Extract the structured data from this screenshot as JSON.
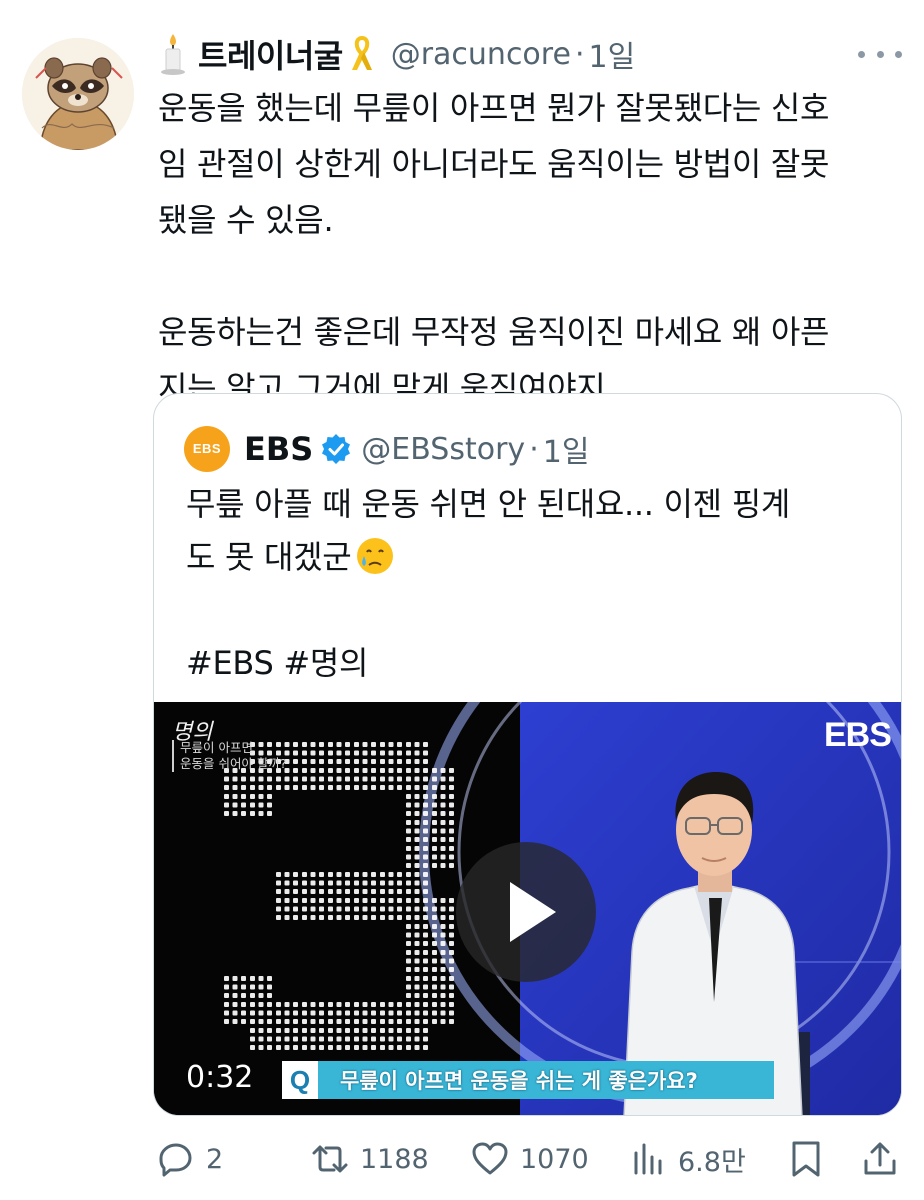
{
  "author": {
    "display_name": "트레이너굴",
    "handle": "@racuncore",
    "separator": "·",
    "time": "1일",
    "avatar_icon": "raccoon-avatar",
    "badge_icons": [
      "candle-emoji",
      "yellow-ribbon-emoji"
    ]
  },
  "tweet": {
    "lines": [
      "운동을 했는데 무릎이 아프면 뭔가 잘못됐다는 신호",
      "임 관절이 상한게 아니더라도 움직이는 방법이 잘못",
      "됐을 수 있음.",
      "운동하는건 좋은데 무작정 움직이진 마세요 왜 아픈",
      "지는 알고 그거에 맞게 움직여야지..."
    ]
  },
  "quote": {
    "logo_text": "EBS",
    "display_name": "EBS",
    "handle": "@EBSstory",
    "separator": "·",
    "time": "1일",
    "verified_icon": "verified-badge-icon",
    "lines": [
      "무릎 아플 때 운동 쉬면 안 된대요... 이젠 핑계",
      "도 못 대겠군",
      "#EBS #명의"
    ],
    "emoji": "crying-face-emoji",
    "video": {
      "show_title": "명의",
      "subtitle_line1": "무릎이 아프면",
      "subtitle_line2": "운동을 쉬어야 할까?",
      "countdown_digit": "3",
      "brand_mark": "EBS",
      "duration": "0:32",
      "caption_prefix": "Q",
      "caption": "무릎이 아프면 운동을 쉬는 게 좋은가요?",
      "play_icon": "play-icon"
    }
  },
  "actions": {
    "reply_count": "2",
    "retweet_count": "1188",
    "like_count": "1070",
    "views_count": "6.8만"
  },
  "colors": {
    "text": "#0f1419",
    "secondary": "#536471",
    "border": "#cfd9de",
    "verified": "#1d9bf0",
    "ebs_orange": "#f7a21b",
    "caption_bar": "#39b5d6"
  }
}
